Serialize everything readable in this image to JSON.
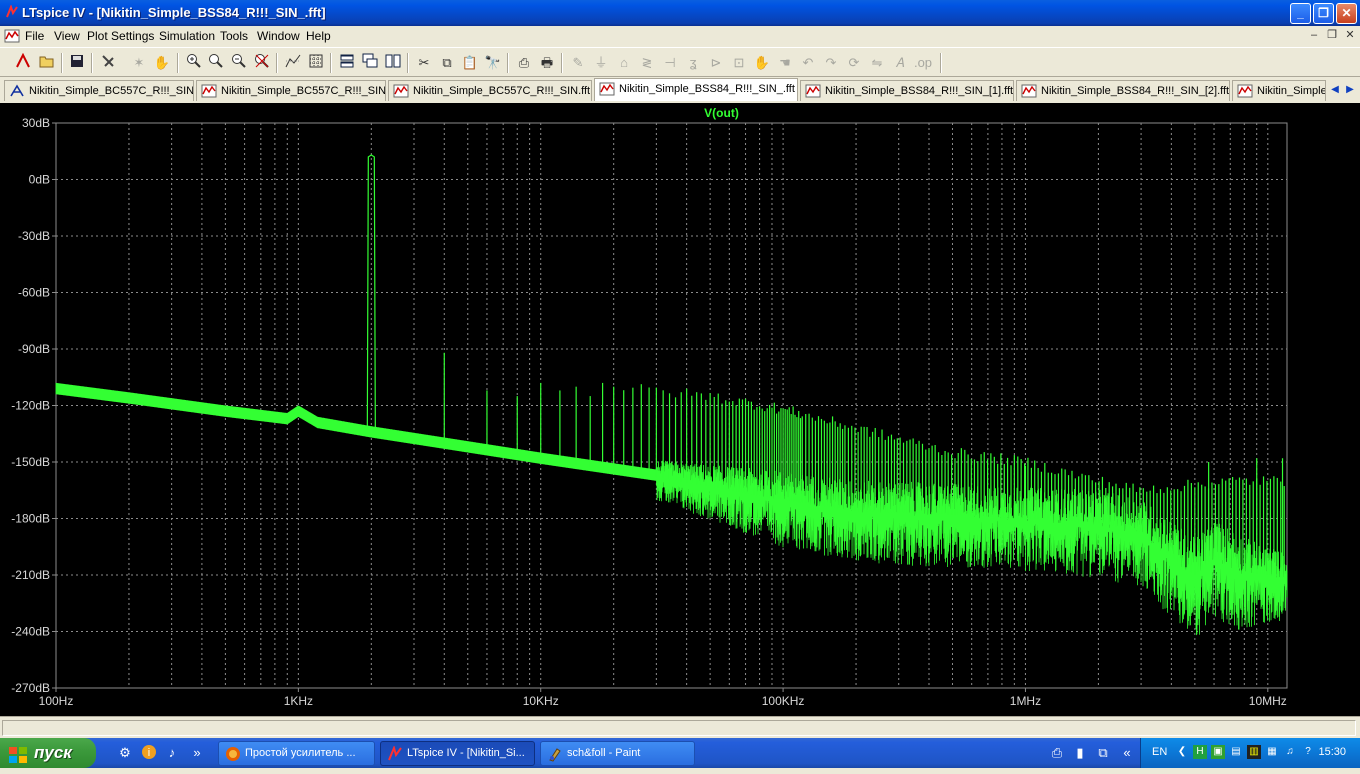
{
  "window": {
    "title": "LTspice IV - [Nikitin_Simple_BSS84_R!!!_SIN_.fft]"
  },
  "menu": [
    "File",
    "View",
    "Plot Settings",
    "Simulation",
    "Tools",
    "Window",
    "Help"
  ],
  "toolbar": {
    "icons": [
      "new-schematic-icon",
      "open-icon",
      "save-icon",
      "control-panel-icon",
      "run-icon",
      "halt-icon",
      "zoom-in-icon",
      "zoom-area-icon",
      "zoom-out-icon",
      "zoom-cancel-icon",
      "autorange-icon",
      "grid-icon",
      "tile-horizontal-icon",
      "cascade-icon",
      "tile-vertical-icon",
      "cut-icon",
      "copy-icon",
      "paste-icon",
      "find-icon",
      "print-preview-icon",
      "print-icon",
      "wire-icon",
      "ground-icon",
      "label-icon",
      "resistor-icon",
      "capacitor-icon",
      "inductor-icon",
      "diode-icon",
      "component-icon",
      "move-icon",
      "drag-icon",
      "undo-icon",
      "redo-icon",
      "rotate-icon",
      "mirror-icon",
      "text-icon",
      "spice-directive-icon"
    ]
  },
  "tabs": [
    {
      "label": "Nikitin_Simple_BC557C_R!!!_SIN",
      "kind": "schematic"
    },
    {
      "label": "Nikitin_Simple_BC557C_R!!!_SIN",
      "kind": "waveform"
    },
    {
      "label": "Nikitin_Simple_BC557C_R!!!_SIN.fft",
      "kind": "waveform"
    },
    {
      "label": "Nikitin_Simple_BSS84_R!!!_SIN_.fft",
      "kind": "waveform",
      "active": true
    },
    {
      "label": "Nikitin_Simple_BSS84_R!!!_SIN_[1].fft",
      "kind": "waveform"
    },
    {
      "label": "Nikitin_Simple_BSS84_R!!!_SIN_[2].fft",
      "kind": "waveform"
    },
    {
      "label": "Nikitin_Simple_",
      "kind": "waveform"
    }
  ],
  "colors": {
    "trace": "#33ff33",
    "grid": "#8c8c8c",
    "axis_text": "#d8d8d8",
    "background": "#000000",
    "title_text": "#33ff33"
  },
  "plot": {
    "trace_name": "V(out)",
    "y_ticks": [
      "30dB",
      "0dB",
      "-30dB",
      "-60dB",
      "-90dB",
      "-120dB",
      "-150dB",
      "-180dB",
      "-210dB",
      "-240dB",
      "-270dB"
    ],
    "x_ticks": [
      "100Hz",
      "1KHz",
      "10KHz",
      "100KHz",
      "1MHz",
      "10MHz"
    ]
  },
  "chart_data": {
    "type": "line",
    "title": "V(out)",
    "xlabel": "",
    "ylabel": "",
    "x_scale": "log",
    "xlim": [
      100,
      12000000
    ],
    "ylim": [
      -270,
      30
    ],
    "y_unit": "dB",
    "series": [
      {
        "name": "V(out)",
        "floor": [
          [
            100,
            -112
          ],
          [
            200,
            -117
          ],
          [
            500,
            -124
          ],
          [
            900,
            -128
          ],
          [
            1000,
            -124
          ],
          [
            1200,
            -130
          ],
          [
            2000,
            -135
          ],
          [
            4000,
            -141
          ],
          [
            10000,
            -149
          ],
          [
            30000,
            -158
          ],
          [
            60000,
            -165
          ],
          [
            100000,
            -170
          ],
          [
            200000,
            -176
          ],
          [
            500000,
            -178
          ],
          [
            1000000,
            -180
          ],
          [
            2000000,
            -182
          ],
          [
            3000000,
            -187
          ],
          [
            4000000,
            -200
          ],
          [
            5000000,
            -210
          ],
          [
            6000000,
            -200
          ],
          [
            8000000,
            -208
          ],
          [
            10000000,
            -210
          ],
          [
            12000000,
            -212
          ]
        ],
        "spread": [
          [
            30000,
            8
          ],
          [
            100000,
            18
          ],
          [
            300000,
            20
          ],
          [
            1000000,
            20
          ],
          [
            3000000,
            22
          ],
          [
            5000000,
            25
          ],
          [
            7000000,
            25
          ],
          [
            12000000,
            15
          ]
        ],
        "harmonics": [
          [
            2000,
            13
          ],
          [
            4000,
            -92
          ],
          [
            6000,
            -112
          ],
          [
            8000,
            -115
          ],
          [
            10000,
            -108
          ],
          [
            12000,
            -112
          ],
          [
            14000,
            -110
          ],
          [
            16000,
            -115
          ],
          [
            18000,
            -108
          ],
          [
            20000,
            -110
          ]
        ],
        "harmonic_spacing": 2000,
        "harmonic_envelope": [
          [
            20000,
            -110
          ],
          [
            50000,
            -115
          ],
          [
            100000,
            -122
          ],
          [
            200000,
            -132
          ],
          [
            500000,
            -145
          ],
          [
            1000000,
            -150
          ],
          [
            2000000,
            -160
          ],
          [
            3000000,
            -165
          ],
          [
            7000000,
            -160
          ],
          [
            12000000,
            -160
          ]
        ],
        "spurs": [
          [
            1000000,
            -152
          ],
          [
            5700000,
            -150
          ],
          [
            9000000,
            -148
          ],
          [
            11500000,
            -148
          ]
        ]
      }
    ]
  },
  "taskbar": {
    "start": "пуск",
    "tasks": [
      {
        "label": "Простой усилитель ...",
        "icon": "firefox-icon"
      },
      {
        "label": "LTspice IV - [Nikitin_Si...",
        "icon": "ltspice-icon",
        "active": true
      },
      {
        "label": "sch&foll - Paint",
        "icon": "paint-icon"
      }
    ],
    "lang": "EN",
    "clock": "15:30"
  }
}
